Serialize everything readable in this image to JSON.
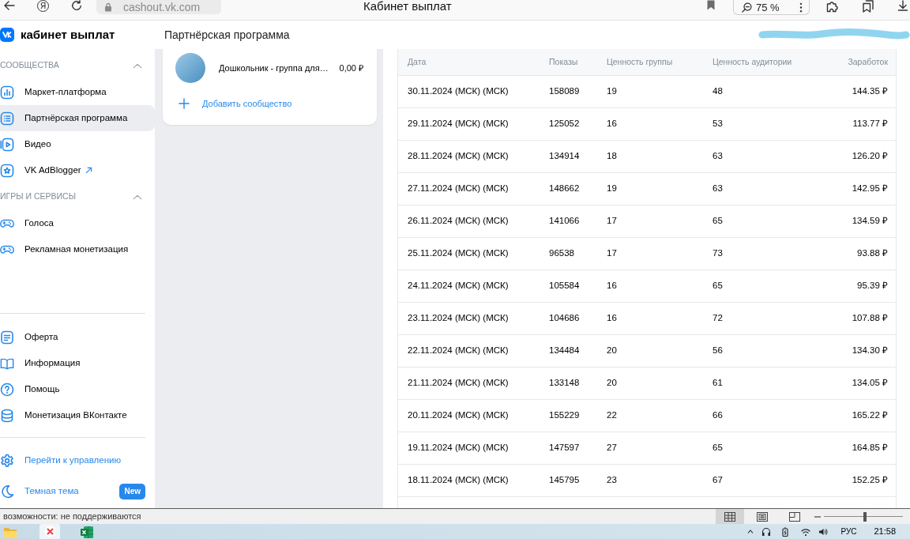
{
  "browser": {
    "logo_letter": "Я",
    "url": "cashout.vk.com",
    "title": "Кабинет выплат",
    "zoom": "75 %"
  },
  "header": {
    "app_title": "кабинет выплат",
    "page_title": "Партнёрская программа"
  },
  "sidebar": {
    "sections": [
      {
        "title": "СООБЩЕСТВА",
        "expanded": true,
        "items": [
          {
            "label": "Маркет-платформа",
            "selected": false,
            "external": false
          },
          {
            "label": "Партнёрская программа",
            "selected": true,
            "external": false
          },
          {
            "label": "Видео",
            "selected": false,
            "external": false
          },
          {
            "label": "VK AdBlogger",
            "selected": false,
            "external": true
          }
        ]
      },
      {
        "title": "ИГРЫ И СЕРВИСЫ",
        "expanded": true,
        "items": [
          {
            "label": "Голоса",
            "selected": false,
            "external": false
          },
          {
            "label": "Рекламная монетизация",
            "selected": false,
            "external": false
          }
        ]
      }
    ],
    "links": [
      "Оферта",
      "Информация",
      "Помощь",
      "Монетизация ВКонтакте"
    ],
    "actions": [
      {
        "label": "Перейти к управлению"
      },
      {
        "label": "Темная тема",
        "badge": "New"
      }
    ]
  },
  "communities": {
    "items": [
      {
        "name": "Дошкольник - группа для…",
        "amount": "0,00 ₽"
      }
    ],
    "add_label": "Добавить сообщество"
  },
  "table": {
    "columns": [
      "Дата",
      "Показы",
      "Ценность группы",
      "Ценность аудитории",
      "Заработок"
    ],
    "rows": [
      [
        "30.11.2024 (МСК) (МСК)",
        "158089",
        "19",
        "48",
        "144.35 ₽"
      ],
      [
        "29.11.2024 (МСК) (МСК)",
        "125052",
        "16",
        "53",
        "113.77 ₽"
      ],
      [
        "28.11.2024 (МСК) (МСК)",
        "134914",
        "18",
        "63",
        "126.20 ₽"
      ],
      [
        "27.11.2024 (МСК) (МСК)",
        "148662",
        "19",
        "63",
        "142.95 ₽"
      ],
      [
        "26.11.2024 (МСК) (МСК)",
        "141066",
        "17",
        "65",
        "134.59 ₽"
      ],
      [
        "25.11.2024 (МСК) (МСК)",
        "96538",
        "17",
        "73",
        "93.88 ₽"
      ],
      [
        "24.11.2024 (МСК) (МСК)",
        "105584",
        "16",
        "65",
        "95.39 ₽"
      ],
      [
        "23.11.2024 (МСК) (МСК)",
        "104686",
        "16",
        "72",
        "107.88 ₽"
      ],
      [
        "22.11.2024 (МСК) (МСК)",
        "134484",
        "20",
        "56",
        "134.30 ₽"
      ],
      [
        "21.11.2024 (МСК) (МСК)",
        "133148",
        "20",
        "61",
        "134.05 ₽"
      ],
      [
        "20.11.2024 (МСК) (МСК)",
        "155229",
        "22",
        "66",
        "165.22 ₽"
      ],
      [
        "19.11.2024 (МСК) (МСК)",
        "147597",
        "27",
        "65",
        "164.85 ₽"
      ],
      [
        "18.11.2024 (МСК) (МСК)",
        "145795",
        "23",
        "67",
        "152.25 ₽"
      ]
    ]
  },
  "status_bar": {
    "text": "возможности: не поддерживаются",
    "views": [
      {
        "selected": true
      },
      {
        "selected": false
      },
      {
        "selected": false
      }
    ],
    "zoom_slider": {
      "level": 0.52
    }
  },
  "taskbar": {
    "language": "РУС",
    "time": "21:58"
  }
}
